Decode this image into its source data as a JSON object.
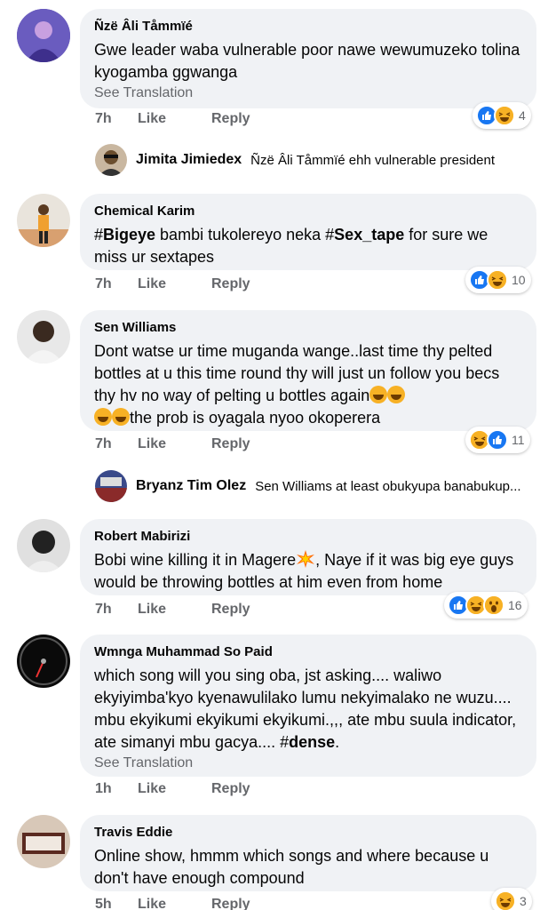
{
  "comments": [
    {
      "author": "Ñzë Âli  Tåmmïé",
      "text": "Gwe leader waba vulnerable poor nawe wewumuzeko tolina kyogamba ggwanga",
      "see_translation": "See Translation",
      "time": "7h",
      "like": "Like",
      "reply": "Reply",
      "reaction_count": "4",
      "avatar_color": "#5b4aa8"
    },
    {
      "author": "Chemical Karim",
      "text_parts": [
        "#",
        "Bigeye",
        " bambi tukolereyo neka #",
        "Sex_tape",
        " for sure we miss ur sextapes"
      ],
      "time": "7h",
      "like": "Like",
      "reply": "Reply",
      "reaction_count": "10",
      "avatar_color": "#d98b3a"
    },
    {
      "author": "Sen Williams",
      "text_line1": "Dont watse ur time muganda wange..last time thy pelted bottles at u this time round thy will just un follow you becs thy hv no way of pelting u bottles again",
      "text_line2": "the prob is oyagala nyoo okoperera",
      "time": "7h",
      "like": "Like",
      "reply": "Reply",
      "reaction_count": "11",
      "avatar_color": "#4a4a4a"
    },
    {
      "author": "Robert Mabirizi",
      "text_a": "Bobi wine killing it in Magere",
      "text_b": ", Naye if it was big eye guys would be throwing bottles at him even from home",
      "time": "7h",
      "like": "Like",
      "reply": "Reply",
      "reaction_count": "16",
      "avatar_color": "#3a3a3a"
    },
    {
      "author": "Wmnga Muhammad So Paid",
      "text_a": "which song will you sing oba, jst asking.... waliwo ekyiyimba'kyo kyenawulilako lumu nekyimalako ne wuzu.... mbu ekyikumi ekyikumi ekyikumi.,,, ate mbu suula indicator, ate simanyi mbu gacya.... #",
      "text_bold": "dense",
      "text_c": ".",
      "see_translation": "See Translation",
      "time": "1h",
      "like": "Like",
      "reply": "Reply",
      "avatar_color": "#1a1a1a"
    },
    {
      "author": "Travis Eddie",
      "text": "Online show, hmmm which songs and where because u don't have enough compound",
      "time": "5h",
      "like": "Like",
      "reply": "Reply",
      "reaction_count": "3",
      "avatar_color": "#8a6a5a"
    }
  ],
  "replies": [
    {
      "author": "Jimita Jimiedex",
      "text": "Ñzë Âli  Tåmmïé ehh    vulnerable president",
      "avatar_color": "#6b4e2e"
    },
    {
      "author": "Bryanz Tim Olez",
      "text": "Sen Williams at least obukyupa banabukup...",
      "avatar_color": "#8a2a2a"
    }
  ],
  "colors": {
    "bubble": "#f0f2f5",
    "secondary_text": "#65676b",
    "like_blue": "#1877f2",
    "haha_yellow": "#f7b125"
  }
}
